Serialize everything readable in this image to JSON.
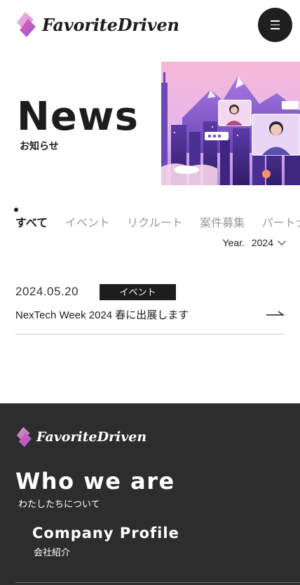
{
  "header": {
    "brand": "FavoriteDriven",
    "menu_icon": "hamburger-icon"
  },
  "hero": {
    "title": "News",
    "subtitle": "お知らせ"
  },
  "tabs": [
    {
      "label": "すべて",
      "active": true
    },
    {
      "label": "イベント",
      "active": false
    },
    {
      "label": "リクルート",
      "active": false
    },
    {
      "label": "案件募集",
      "active": false
    },
    {
      "label": "パートナー",
      "active": false
    }
  ],
  "year_filter": {
    "label": "Year.",
    "value": "2024"
  },
  "news": [
    {
      "date": "2024.05.20",
      "tag": "イベント",
      "title": "NexTech Week 2024 春に出展します"
    }
  ],
  "footer": {
    "brand": "FavoriteDriven",
    "who_title": "Who we are",
    "who_subtitle": "わたしたちについて",
    "links": [
      {
        "title": "Company Profile",
        "subtitle": "会社紹介"
      }
    ]
  },
  "colors": {
    "text": "#1d1d1f",
    "footer_bg": "#2d2d2d",
    "logo_pink": "#ec4f8a",
    "logo_purple": "#8b5cf6"
  }
}
